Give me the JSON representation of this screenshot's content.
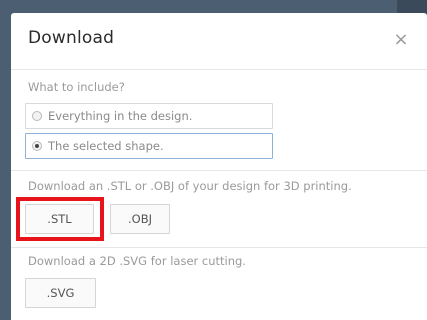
{
  "dialog": {
    "title": "Download",
    "close_glyph": "×",
    "include": {
      "label": "What to include?",
      "options": [
        {
          "label": "Everything in the design.",
          "selected": false
        },
        {
          "label": "The selected shape.",
          "selected": true
        }
      ]
    },
    "print3d": {
      "label": "Download an .STL or .OBJ of your design for 3D printing.",
      "buttons": [
        ".STL",
        ".OBJ"
      ]
    },
    "laser": {
      "label": "Download a 2D .SVG for laser cutting.",
      "buttons": [
        ".SVG"
      ]
    }
  },
  "colors": {
    "backdrop": "#4c5f72",
    "highlight": "#e8131b",
    "selected_border": "#8fb2d8"
  }
}
